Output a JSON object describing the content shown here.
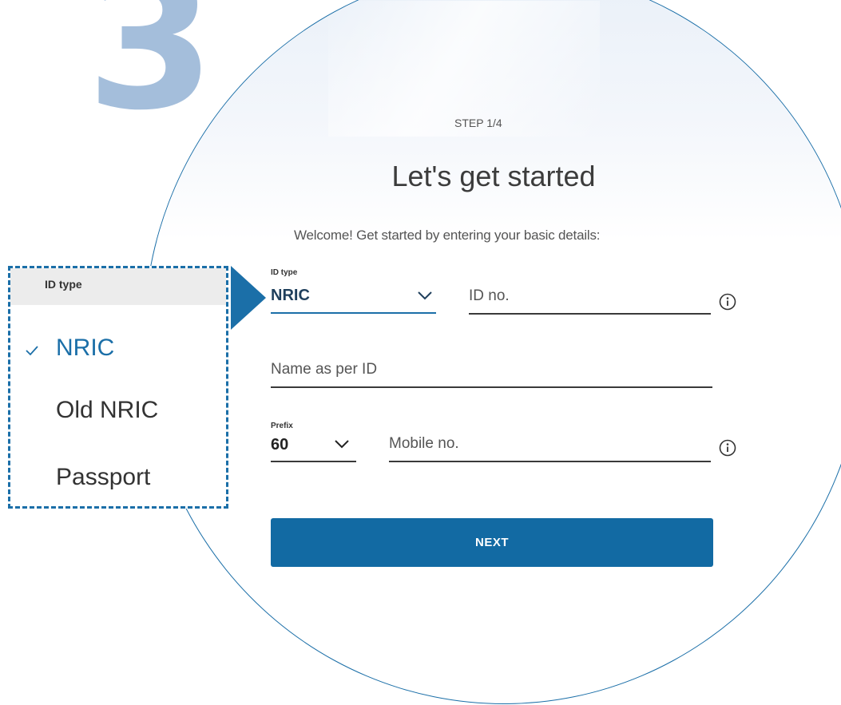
{
  "step_number": "3",
  "header": {
    "step": "STEP 1/4",
    "title": "Let's get started",
    "subtitle": "Welcome! Get started by entering your basic details:"
  },
  "id_type": {
    "label": "ID type",
    "value": "NRIC"
  },
  "id_no": {
    "placeholder": "ID no."
  },
  "name": {
    "placeholder": "Name as per ID"
  },
  "prefix": {
    "label": "Prefix",
    "value": "60"
  },
  "mobile": {
    "placeholder": "Mobile no."
  },
  "next_button": {
    "label": "NEXT"
  },
  "dropdown": {
    "header": "ID type",
    "options": [
      {
        "label": "NRIC",
        "selected": true
      },
      {
        "label": "Old NRIC",
        "selected": false
      },
      {
        "label": "Passport",
        "selected": false
      }
    ]
  },
  "icons": {
    "chevron": "chevron-down-icon",
    "info": "info-icon",
    "check": "check-icon"
  },
  "colors": {
    "accent": "#126aa3",
    "step_number": "#a4bedb",
    "selected_option": "#1b6fa8"
  }
}
